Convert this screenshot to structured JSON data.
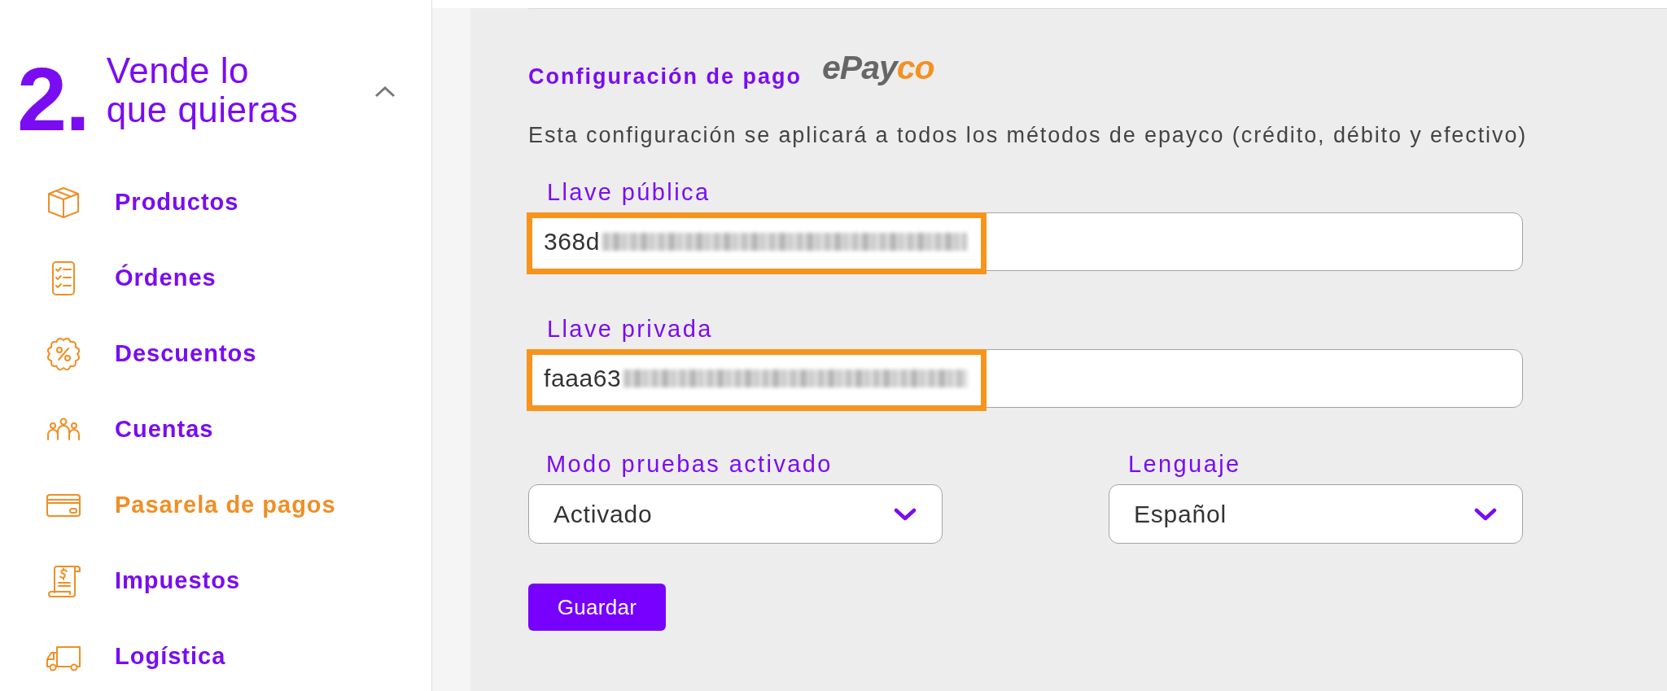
{
  "sidebar": {
    "step_number": "2.",
    "title": "Vende lo que quieras",
    "expanded": true,
    "items": [
      {
        "label": "Productos",
        "selected": false
      },
      {
        "label": "Órdenes",
        "selected": false
      },
      {
        "label": "Descuentos",
        "selected": false
      },
      {
        "label": "Cuentas",
        "selected": false
      },
      {
        "label": "Pasarela de pagos",
        "selected": true
      },
      {
        "label": "Impuestos",
        "selected": false
      },
      {
        "label": "Logística",
        "selected": false
      }
    ]
  },
  "content": {
    "heading": "Configuración de pago",
    "logo": [
      {
        "text": "ePay",
        "color": "#666666"
      },
      {
        "text": "co",
        "color": "#f29222"
      }
    ],
    "description": "Esta configuración se aplicará a todos los métodos de epayco (crédito, débito y efectivo)",
    "key_fields": [
      {
        "label": "Llave pública",
        "value": "368d",
        "redacted": true,
        "highlighted": true
      },
      {
        "label": "Llave privada",
        "value": "faaa63",
        "redacted": true,
        "highlighted": true
      }
    ],
    "selects": [
      {
        "label": "Modo pruebas activado",
        "value": "Activado"
      },
      {
        "label": "Lenguaje",
        "value": "Español"
      }
    ],
    "save_button": "Guardar"
  }
}
